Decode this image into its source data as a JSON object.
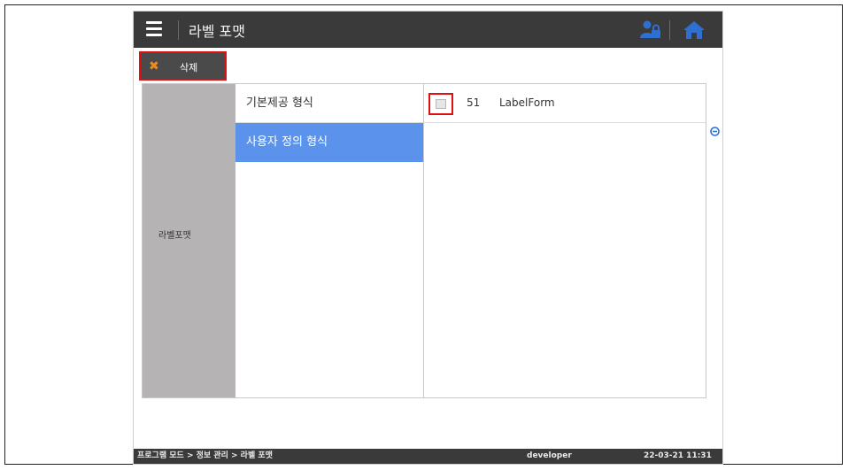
{
  "header": {
    "title": "라벨 포맷",
    "menu_icon": "hamburger-menu-icon",
    "user_icon": "user-lock-icon",
    "home_icon": "home-icon"
  },
  "toolbar": {
    "delete_label": "삭제",
    "delete_icon": "x-icon"
  },
  "sidebar": {
    "label": "라벨포맷"
  },
  "format_types": [
    {
      "label": "기본제공 형식",
      "selected": false
    },
    {
      "label": "사용자 정의 형식",
      "selected": true
    }
  ],
  "forms": [
    {
      "number": "51",
      "name": "LabelForm",
      "checked": false
    }
  ],
  "status": {
    "path": "프로그램 모드 > 정보 관리 > 라벨 포맷",
    "user": "developer",
    "datetime": "22-03-21 11:31"
  },
  "colors": {
    "topbar": "#3a3a3a",
    "selected": "#5b93ec",
    "highlight_border": "#e01010",
    "delete_icon": "#ef8a22",
    "side_label_bg": "#b5b3b3",
    "accent_blue": "#2f6fd1"
  }
}
